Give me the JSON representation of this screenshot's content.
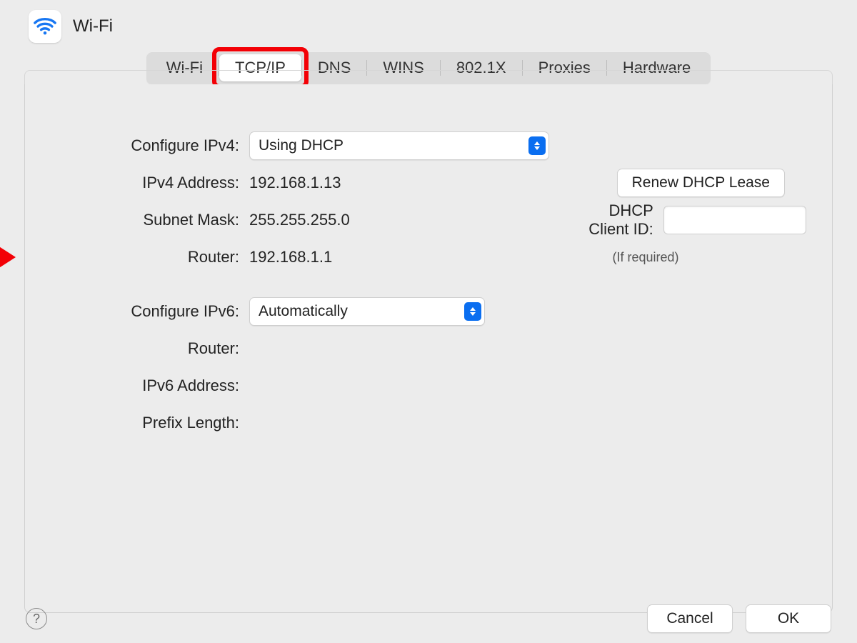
{
  "header": {
    "title": "Wi-Fi"
  },
  "tabs": {
    "items": [
      "Wi-Fi",
      "TCP/IP",
      "DNS",
      "WINS",
      "802.1X",
      "Proxies",
      "Hardware"
    ],
    "selected": "TCP/IP"
  },
  "ipv4": {
    "configure_label": "Configure IPv4:",
    "configure_value": "Using DHCP",
    "address_label": "IPv4 Address:",
    "address_value": "192.168.1.13",
    "subnet_label": "Subnet Mask:",
    "subnet_value": "255.255.255.0",
    "router_label": "Router:",
    "router_value": "192.168.1.1",
    "renew_button": "Renew DHCP Lease",
    "client_id_label": "DHCP Client ID:",
    "client_id_value": "",
    "client_id_hint": "(If required)"
  },
  "ipv6": {
    "configure_label": "Configure IPv6:",
    "configure_value": "Automatically",
    "router_label": "Router:",
    "router_value": "",
    "address_label": "IPv6 Address:",
    "address_value": "",
    "prefix_label": "Prefix Length:",
    "prefix_value": ""
  },
  "footer": {
    "cancel": "Cancel",
    "ok": "OK"
  }
}
